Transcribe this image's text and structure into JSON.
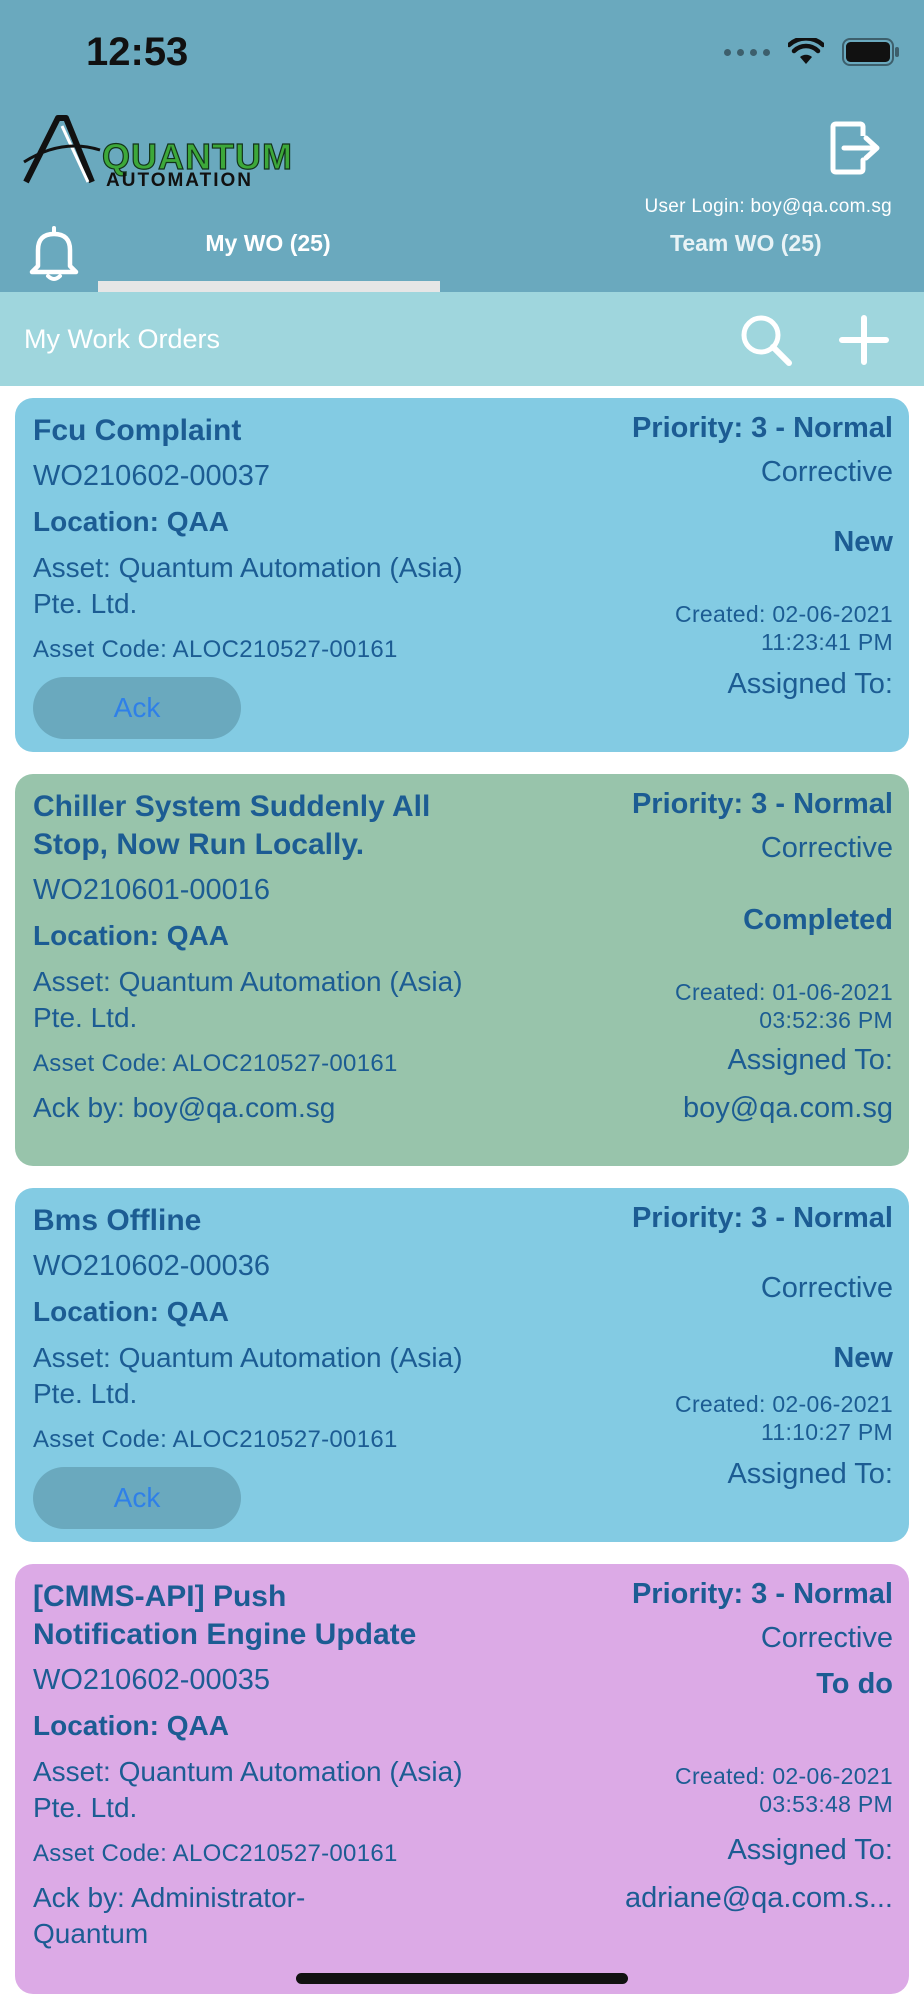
{
  "status_bar": {
    "time": "12:53"
  },
  "header": {
    "logo_line1": "QUANTUM",
    "logo_line2": "AUTOMATION",
    "user_login": "User Login: boy@qa.com.sg",
    "tabs": [
      {
        "label": "My WO (25)",
        "active": true
      },
      {
        "label": "Team WO (25)",
        "active": false
      }
    ]
  },
  "toolbar": {
    "title": "My Work Orders"
  },
  "colors": {
    "header_bg": "#6aa9be",
    "toolbar_bg": "#9fd6dd",
    "card_blue": "#83cbe3",
    "card_green": "#98c4ab",
    "card_pink": "#dcaae6",
    "text": "#1c5c93",
    "ack_link": "#2f80e8"
  },
  "work_orders": [
    {
      "title": "Fcu Complaint",
      "wo_number": "WO210602-00037",
      "location": "Location: QAA",
      "asset": "Asset: Quantum Automation (Asia) Pte. Ltd.",
      "asset_code": "Asset Code: ALOC210527-00161",
      "priority": "Priority: 3 - Normal",
      "type": "Corrective",
      "status": "New",
      "created_line1": "Created: 02-06-2021",
      "created_line2": "11:23:41 PM",
      "assigned_label": "Assigned To:",
      "ack_button": "Ack"
    },
    {
      "title_line1": "Chiller System Suddenly All",
      "title_line2": "Stop, Now Run Locally.",
      "wo_number": "WO210601-00016",
      "location": "Location: QAA",
      "asset": "Asset: Quantum Automation (Asia) Pte. Ltd.",
      "asset_code": "Asset Code: ALOC210527-00161",
      "ack_by": "Ack by: boy@qa.com.sg",
      "priority": "Priority: 3 - Normal",
      "type": "Corrective",
      "status": "Completed",
      "created_line1": "Created: 01-06-2021",
      "created_line2": "03:52:36 PM",
      "assigned_label": "Assigned To:",
      "assignee": "boy@qa.com.sg"
    },
    {
      "title": "Bms Offline",
      "wo_number": "WO210602-00036",
      "location": "Location: QAA",
      "asset": "Asset: Quantum Automation (Asia) Pte. Ltd.",
      "asset_code": "Asset Code: ALOC210527-00161",
      "priority": "Priority: 3 - Normal",
      "type": "Corrective",
      "status": "New",
      "created_line1": "Created: 02-06-2021",
      "created_line2": "11:10:27 PM",
      "assigned_label": "Assigned To:",
      "ack_button": "Ack"
    },
    {
      "title_line1": "[CMMS-API] Push",
      "title_line2": "Notification Engine Update",
      "wo_number": "WO210602-00035",
      "location": "Location: QAA",
      "asset": "Asset: Quantum Automation (Asia) Pte. Ltd.",
      "asset_code": "Asset Code: ALOC210527-00161",
      "ack_by": "Ack by: Administrator-Quantum",
      "priority": "Priority: 3 - Normal",
      "type": "Corrective",
      "status": "To do",
      "created_line1": "Created: 02-06-2021",
      "created_line2": "03:53:48 PM",
      "assigned_label": "Assigned To:",
      "assignee": "adriane@qa.com.s..."
    }
  ]
}
